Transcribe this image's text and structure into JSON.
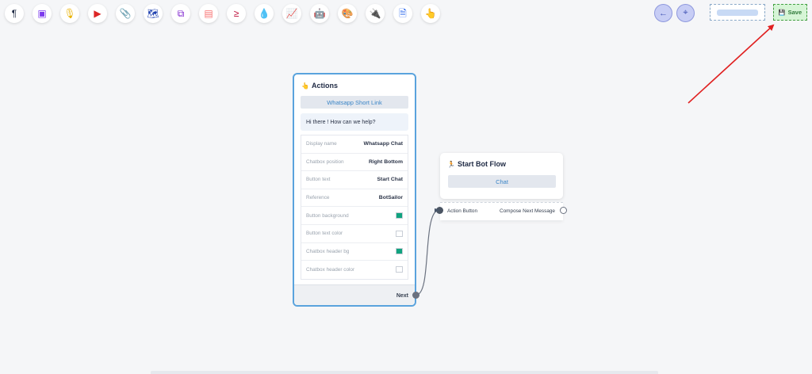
{
  "toolbar": {
    "tools": [
      {
        "name": "paragraph-icon",
        "glyph": "¶",
        "color": "#1f2a44"
      },
      {
        "name": "image-icon",
        "glyph": "▣",
        "color": "#7c3aed"
      },
      {
        "name": "microphone-icon",
        "glyph": "🎙",
        "color": "#eab308"
      },
      {
        "name": "youtube-icon",
        "glyph": "▶",
        "color": "#dc2626"
      },
      {
        "name": "paperclip-icon",
        "glyph": "📎",
        "color": "#16a34a"
      },
      {
        "name": "map-icon",
        "glyph": "🗺",
        "color": "#1e40af"
      },
      {
        "name": "media-frame-icon",
        "glyph": "⧉",
        "color": "#7e22ce"
      },
      {
        "name": "card-icon",
        "glyph": "▤",
        "color": "#f87171"
      },
      {
        "name": "terminal-icon",
        "glyph": "≥",
        "color": "#be123c"
      },
      {
        "name": "drop-icon",
        "glyph": "💧",
        "color": "#dc2626"
      },
      {
        "name": "chart-icon",
        "glyph": "📈",
        "color": "#16a34a"
      },
      {
        "name": "robot-icon",
        "glyph": "🤖",
        "color": "#4338ca"
      },
      {
        "name": "palette-icon",
        "glyph": "🎨",
        "color": "#22c55e"
      },
      {
        "name": "plug-icon",
        "glyph": "🔌",
        "color": "#7c3aed"
      },
      {
        "name": "document-icon",
        "glyph": "🗎",
        "color": "#2563eb"
      },
      {
        "name": "pointer-hand-icon",
        "glyph": "👆",
        "color": "#be123c"
      }
    ]
  },
  "header": {
    "back_glyph": "←",
    "center_glyph": "⌖",
    "save_glyph": "💾",
    "save_label": "Save"
  },
  "actions_card": {
    "title_glyph": "👆",
    "title": "Actions",
    "link_button": "Whatsapp Short Link",
    "message": "Hi there ! How can we help?",
    "rows": [
      {
        "label": "Display name",
        "value": "Whatsapp Chat"
      },
      {
        "label": "Chatbox position",
        "value": "Right Bottom"
      },
      {
        "label": "Button text",
        "value": "Start Chat"
      },
      {
        "label": "Reference",
        "value": "BotSailor"
      },
      {
        "label": "Button background",
        "swatch": "#10a37f"
      },
      {
        "label": "Button text color",
        "swatch": "#ffffff"
      },
      {
        "label": "Chatbox header bg",
        "swatch": "#10a37f"
      },
      {
        "label": "Chatbox header color",
        "swatch": "#ffffff"
      }
    ],
    "footer_label": "Next"
  },
  "start_card": {
    "title_glyph": "🏃",
    "title": "Start Bot Flow",
    "chat_button": "Chat",
    "input_port_label": "Action Button",
    "output_port_label": "Compose Next Message"
  },
  "colors": {
    "accent_blue": "#5aa3dd",
    "link_text": "#3c86c7",
    "save_green": "#2f7a3a",
    "arrow_red": "#e02020"
  }
}
